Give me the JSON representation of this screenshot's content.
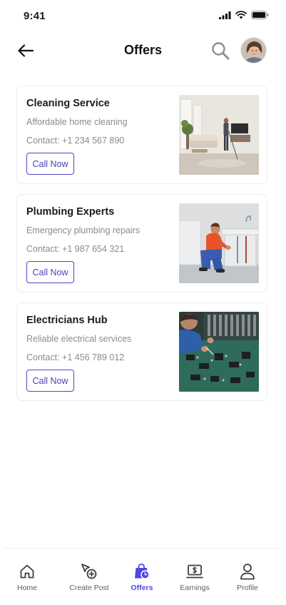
{
  "status_bar": {
    "time": "9:41"
  },
  "header": {
    "title": "Offers"
  },
  "offers": [
    {
      "title": "Cleaning Service",
      "description": "Affordable home cleaning",
      "contact": "Contact: +1 234 567 890",
      "cta": "Call Now"
    },
    {
      "title": "Plumbing Experts",
      "description": "Emergency plumbing repairs",
      "contact": "Contact: +1 987 654 321",
      "cta": "Call Now"
    },
    {
      "title": "Electricians Hub",
      "description": "Reliable electrical services",
      "contact": "Contact: +1 456 789 012",
      "cta": "Call Now"
    }
  ],
  "bottom_nav": {
    "items": [
      {
        "label": "Home",
        "icon": "home-icon"
      },
      {
        "label": "Create Post",
        "icon": "create-post-icon"
      },
      {
        "label": "Offers",
        "icon": "offers-bag-icon",
        "active": true
      },
      {
        "label": "Earnings",
        "icon": "earnings-icon"
      },
      {
        "label": "Profile",
        "icon": "profile-icon"
      }
    ]
  },
  "colors": {
    "accent": "#4f46e5",
    "button_border": "#4f46c8",
    "muted_text": "#8b8b92",
    "card_border": "#ececef"
  }
}
